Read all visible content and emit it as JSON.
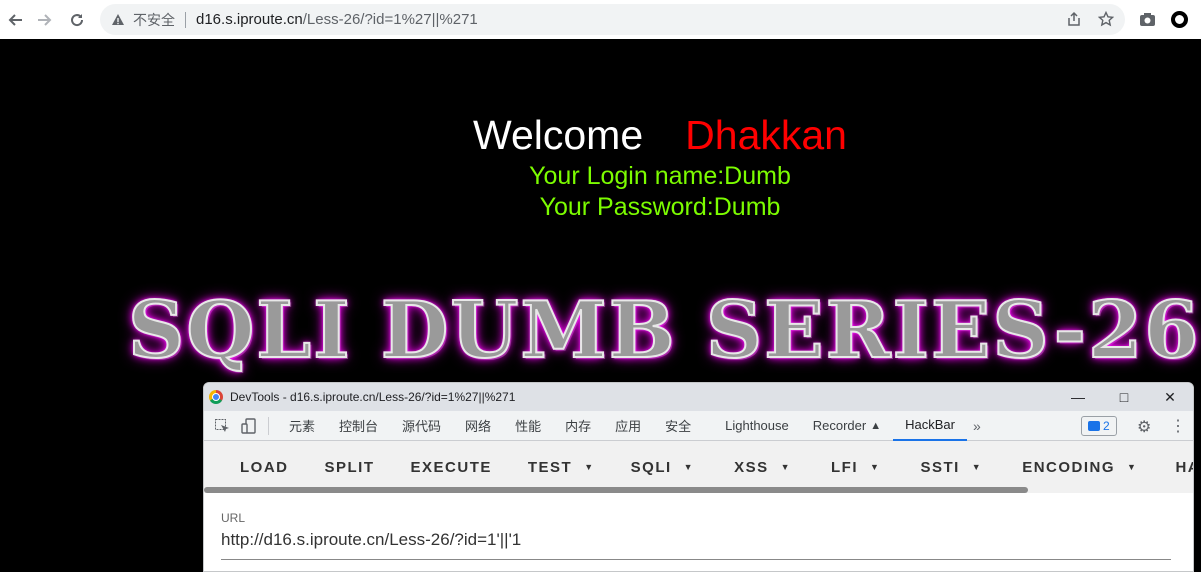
{
  "browser": {
    "security_label": "不安全",
    "url_host": "d16.s.iproute.cn",
    "url_path": "/Less-26/?id=1%27||%271"
  },
  "page": {
    "welcome": "Welcome",
    "name": "Dhakkan",
    "login_name": "Your Login name:Dumb",
    "password": "Your Password:Dumb",
    "series_title": "SQLI DUMB SERIES-26"
  },
  "devtools": {
    "title": "DevTools - d16.s.iproute.cn/Less-26/?id=1%27||%271",
    "tabs": [
      "元素",
      "控制台",
      "源代码",
      "网络",
      "性能",
      "内存",
      "应用",
      "安全",
      "Lighthouse",
      "Recorder",
      "HackBar"
    ],
    "active_tab": "HackBar",
    "message_count": "2"
  },
  "hackbar": {
    "buttons": {
      "load": "LOAD",
      "split": "SPLIT",
      "execute": "EXECUTE",
      "test": "TEST",
      "sqli": "SQLI",
      "xss": "XSS",
      "lfi": "LFI",
      "ssti": "SSTI",
      "encoding": "ENCODING",
      "hash": "HASH"
    },
    "url_label": "URL",
    "url_value": "http://d16.s.iproute.cn/Less-26/?id=1'||'1"
  },
  "colors": {
    "welcome": "#ffffff",
    "name": "#ff0000",
    "credentials": "#7cfc00",
    "title_glow": "#ff00ff",
    "active_tab_underline": "#1a73e8"
  }
}
